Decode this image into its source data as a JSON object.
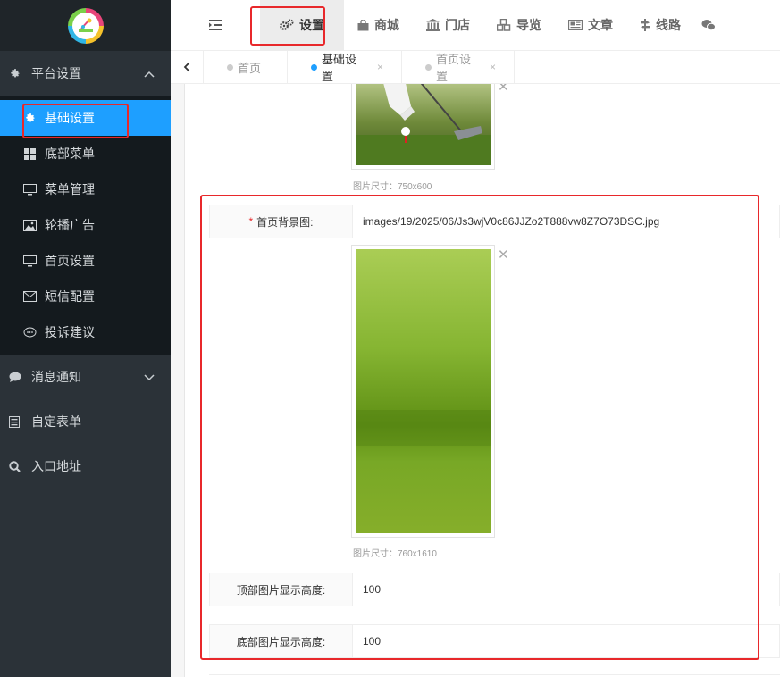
{
  "sidebar": {
    "groups": [
      {
        "label": "平台设置",
        "icon": "gear-icon",
        "expanded": true
      },
      {
        "label": "消息通知",
        "icon": "chat-icon",
        "expanded": false
      },
      {
        "label": "自定表单",
        "icon": "form-icon"
      },
      {
        "label": "入口地址",
        "icon": "search-icon"
      }
    ],
    "items": [
      {
        "label": "基础设置",
        "icon": "gear-icon"
      },
      {
        "label": "底部菜单",
        "icon": "grid-icon"
      },
      {
        "label": "菜单管理",
        "icon": "monitor-icon"
      },
      {
        "label": "轮播广告",
        "icon": "image-icon"
      },
      {
        "label": "首页设置",
        "icon": "monitor-icon"
      },
      {
        "label": "短信配置",
        "icon": "mail-icon"
      },
      {
        "label": "投诉建议",
        "icon": "chat-icon"
      }
    ]
  },
  "topnav": {
    "items": [
      {
        "label": "设置",
        "icon": "gears-icon"
      },
      {
        "label": "商城",
        "icon": "bag-icon"
      },
      {
        "label": "门店",
        "icon": "bank-icon"
      },
      {
        "label": "导览",
        "icon": "cubes-icon"
      },
      {
        "label": "文章",
        "icon": "newspaper-icon"
      },
      {
        "label": "线路",
        "icon": "route-icon"
      }
    ]
  },
  "tabs": [
    {
      "label": "首页"
    },
    {
      "label": "基础设置",
      "close": "×"
    },
    {
      "label": "首页设置",
      "close": "×"
    }
  ],
  "form": {
    "top_image_size": "图片尺寸：750x600",
    "bg_label": "首页背景图:",
    "bg_value": "images/19/2025/06/Js3wjV0c86JJZo2T888vw8Z7O73DSC.jpg",
    "bg_image_size": "图片尺寸：760x1610",
    "top_height_label": "顶部图片显示高度:",
    "top_height_value": "100",
    "bottom_height_label": "底部图片显示高度:",
    "bottom_height_value": "100",
    "close_symbol": "✕"
  },
  "colors": {
    "accent": "#1e9fff",
    "sidebar_bg": "#2b3238",
    "highlight_red": "#e8282b"
  }
}
